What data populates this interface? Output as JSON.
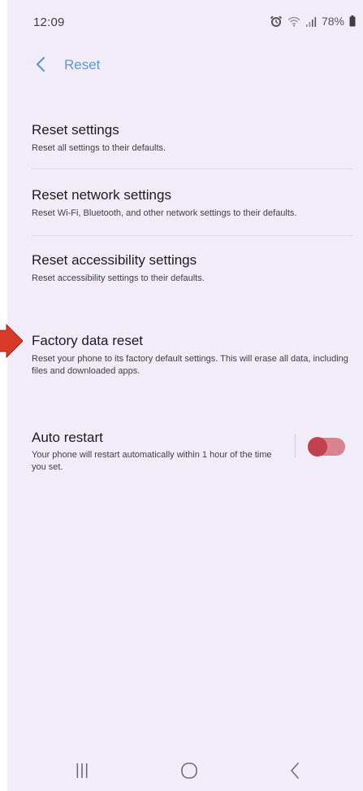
{
  "status_bar": {
    "time": "12:09",
    "battery_text": "78%",
    "icons": [
      "alarm-icon",
      "wifi-icon",
      "signal-icon",
      "battery-icon"
    ]
  },
  "header": {
    "title": "Reset",
    "back_icon": "chevron-left-icon"
  },
  "settings": {
    "items": [
      {
        "title": "Reset settings",
        "description": "Reset all settings to their defaults."
      },
      {
        "title": "Reset network settings",
        "description": "Reset Wi-Fi, Bluetooth, and other network settings to their defaults."
      },
      {
        "title": "Reset accessibility settings",
        "description": "Reset accessibility settings to their defaults."
      },
      {
        "title": "Factory data reset",
        "description": "Reset your phone to its factory default settings. This will erase all data, including files and downloaded apps."
      },
      {
        "title": "Auto restart",
        "description": "Your phone will restart automatically within 1 hour of the time you set.",
        "toggle_on": true
      }
    ]
  },
  "navigation": {
    "buttons": [
      "recent-apps",
      "home",
      "back"
    ]
  },
  "colors": {
    "background": "#f1ecf7",
    "accent": "#5a9ad8",
    "toggle_thumb": "#c3414f",
    "toggle_track": "#d8848f",
    "annotation_arrow": "#d83a2a"
  }
}
